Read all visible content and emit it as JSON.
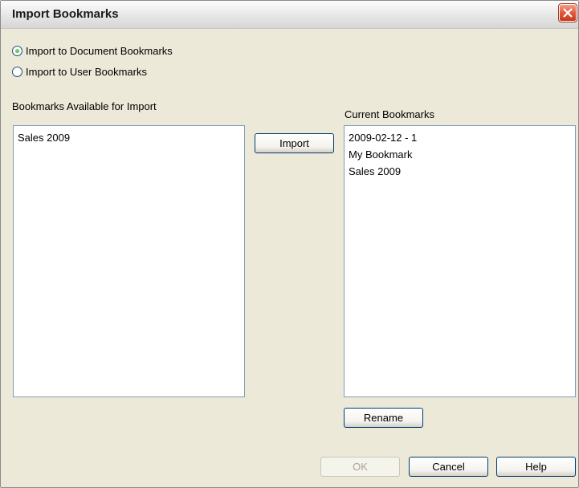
{
  "window": {
    "title": "Import Bookmarks"
  },
  "target": {
    "options": [
      {
        "label": "Import to Document Bookmarks",
        "selected": true
      },
      {
        "label": "Import to User Bookmarks",
        "selected": false
      }
    ]
  },
  "available": {
    "label": "Bookmarks Available for Import",
    "items": [
      "Sales 2009"
    ]
  },
  "current": {
    "label": "Current Bookmarks",
    "items": [
      "2009-02-12 - 1",
      "My Bookmark",
      "Sales 2009"
    ]
  },
  "buttons": {
    "import": "Import",
    "rename": "Rename",
    "ok": "OK",
    "cancel": "Cancel",
    "help": "Help"
  },
  "icons": {
    "close": "close-icon"
  },
  "colors": {
    "dialog_bg": "#ece9d8",
    "close_button": "#e2593a",
    "radio_selected": "#21a121",
    "listbox_border": "#7f9db9"
  }
}
